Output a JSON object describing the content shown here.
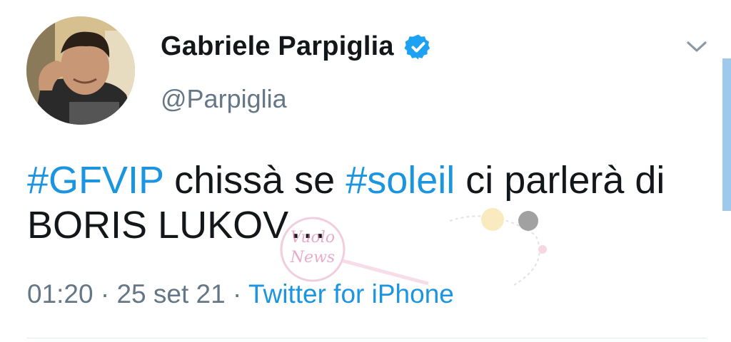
{
  "user": {
    "name": "Gabriele Parpiglia",
    "handle": "@Parpiglia",
    "verified": true
  },
  "tweet": {
    "hashtag1": "#GFVIP",
    "text1": " chissà se ",
    "hashtag2": "#soleil",
    "text2": " ci parlerà di BORIS LUKOV…"
  },
  "meta": {
    "time": "01:20",
    "separator1": " · ",
    "date": "25 set 21",
    "separator2": " · ",
    "source": "Twitter for iPhone"
  },
  "watermark": {
    "line1": "Vuolo",
    "line2": "News"
  },
  "colors": {
    "link": "#1b95e0",
    "secondary_text": "#657786",
    "primary_text": "#14171a",
    "verified_badge": "#1da1f2"
  },
  "icons": {
    "verified": "verified-badge-icon",
    "menu": "chevron-down-icon"
  }
}
